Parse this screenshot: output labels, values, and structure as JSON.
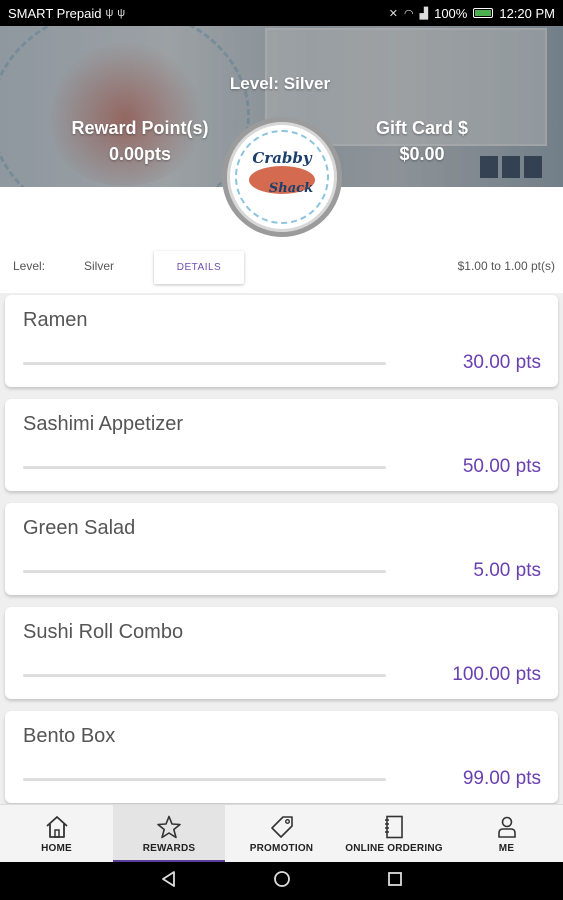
{
  "status_bar": {
    "carrier": "SMART Prepaid",
    "battery": "100%",
    "time": "12:20 PM"
  },
  "header": {
    "level_title": "Level: Silver",
    "reward_points_label": "Reward Point(s)",
    "reward_points_value": "0.00pts",
    "gift_card_label": "Gift Card $",
    "gift_card_value": "$0.00",
    "logo_line1": "Crabby",
    "logo_line2": "Shack"
  },
  "info": {
    "level_label": "Level:",
    "level_value": "Silver",
    "details_button": "DETAILS",
    "rate": "$1.00 to 1.00 pt(s)"
  },
  "rewards": [
    {
      "name": "Ramen",
      "points": "30.00 pts",
      "progress": 0
    },
    {
      "name": "Sashimi Appetizer",
      "points": "50.00 pts",
      "progress": 0
    },
    {
      "name": "Green Salad",
      "points": "5.00 pts",
      "progress": 0
    },
    {
      "name": "Sushi Roll Combo",
      "points": "100.00 pts",
      "progress": 0
    },
    {
      "name": "Bento Box",
      "points": "99.00 pts",
      "progress": 0
    }
  ],
  "nav": {
    "items": [
      {
        "label": "HOME",
        "icon": "home-icon"
      },
      {
        "label": "REWARDS",
        "icon": "star-icon",
        "active": true
      },
      {
        "label": "PROMOTION",
        "icon": "tag-icon"
      },
      {
        "label": "ONLINE ORDERING",
        "icon": "notebook-icon"
      },
      {
        "label": "ME",
        "icon": "person-icon"
      }
    ]
  },
  "colors": {
    "accent": "#6a3fb0",
    "active_nav_indicator": "#5a3e9a"
  }
}
